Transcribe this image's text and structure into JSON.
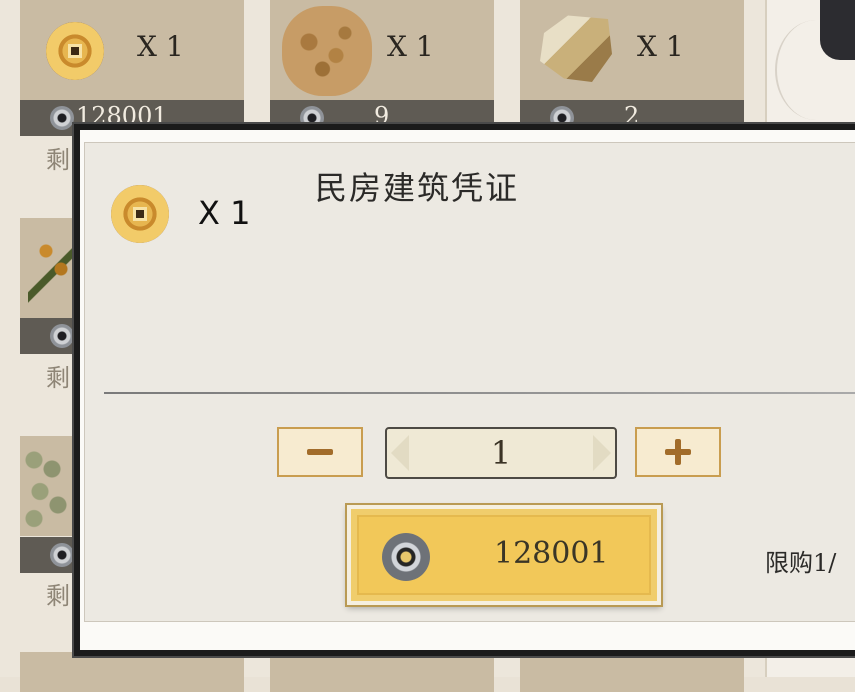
{
  "shop_items": [
    {
      "icon": "copper-coin-icon",
      "qty": "X 1",
      "price": "128001"
    },
    {
      "icon": "grain-icon",
      "qty": "X 1",
      "price": "9"
    },
    {
      "icon": "wood-icon",
      "qty": "X 1",
      "price": "2"
    }
  ],
  "left_column": {
    "remain_label_1": "剩",
    "remain_label_2": "剩",
    "remain_label_3": "剩"
  },
  "modal": {
    "item_icon": "copper-coin-icon",
    "item_qty": "X 1",
    "title": "民房建筑凭证",
    "quantity_value": "1",
    "minus_label": "−",
    "plus_label": "+",
    "buy_price": "128001",
    "currency_icon": "silver-coin-icon",
    "limit_text": "限购1/"
  },
  "colors": {
    "card_bg": "#c9bba3",
    "price_bar_bg": "#5f5b54",
    "buy_button": "#f0cd6c",
    "stepper_accent": "#a26c2a"
  }
}
